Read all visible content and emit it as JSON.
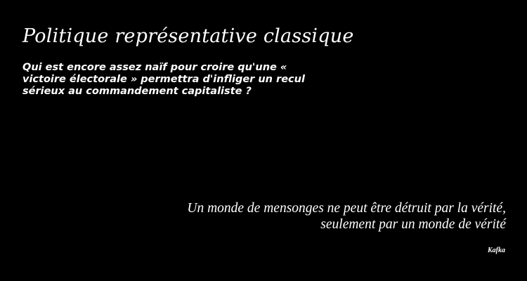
{
  "title": "Politique représentative classique",
  "intro": "Qui est encore assez naïf pour croire qu'une « victoire électorale » permettra d'infliger un recul sérieux au commandement capitaliste ?",
  "quote": {
    "line1": "Un monde de mensonges ne peut être détruit par la vérité,",
    "line2": "seulement par un monde de vérité"
  },
  "author": "Kafka",
  "colors": {
    "background": "#000000",
    "text": "#ffffff"
  }
}
